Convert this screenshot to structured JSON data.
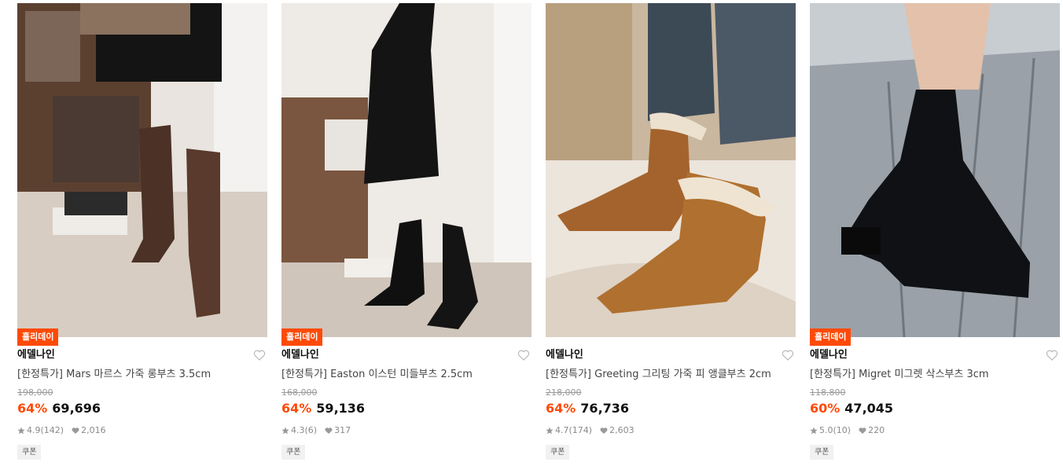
{
  "colors": {
    "accent": "#ff4a07",
    "text": "#111111",
    "muted": "#8a8a8a"
  },
  "products": [
    {
      "badge": "홀리데이",
      "brand": "에델나인",
      "name": "[한정특가] Mars 마르스 가죽 롱부츠 3.5cm",
      "original_price": "198,000",
      "discount": "64%",
      "price": "69,696",
      "rating": "4.9",
      "reviews": "(142)",
      "likes": "2,016",
      "coupon": "쿠폰",
      "image_alt": "brown leather knee-high boots"
    },
    {
      "badge": "홀리데이",
      "brand": "에델나인",
      "name": "[한정특가] Easton 이스턴 미들부츠 2.5cm",
      "original_price": "168,000",
      "discount": "64%",
      "price": "59,136",
      "rating": "4.3",
      "reviews": "(6)",
      "likes": "317",
      "coupon": "쿠폰",
      "image_alt": "black leather middle boots"
    },
    {
      "badge": "",
      "brand": "에델나인",
      "name": "[한정특가] Greeting 그리팅 가죽 피 앵클부츠 2cm",
      "original_price": "218,000",
      "discount": "64%",
      "price": "76,736",
      "rating": "4.7",
      "reviews": "(174)",
      "likes": "2,603",
      "coupon": "쿠폰",
      "image_alt": "camel suede shearling ankle boots"
    },
    {
      "badge": "홀리데이",
      "brand": "에델나인",
      "name": "[한정특가] Migret 미그렛 삭스부츠 3cm",
      "original_price": "118,800",
      "discount": "60%",
      "price": "47,045",
      "rating": "5.0",
      "reviews": "(10)",
      "likes": "220",
      "coupon": "쿠폰",
      "image_alt": "black sock boots"
    }
  ]
}
